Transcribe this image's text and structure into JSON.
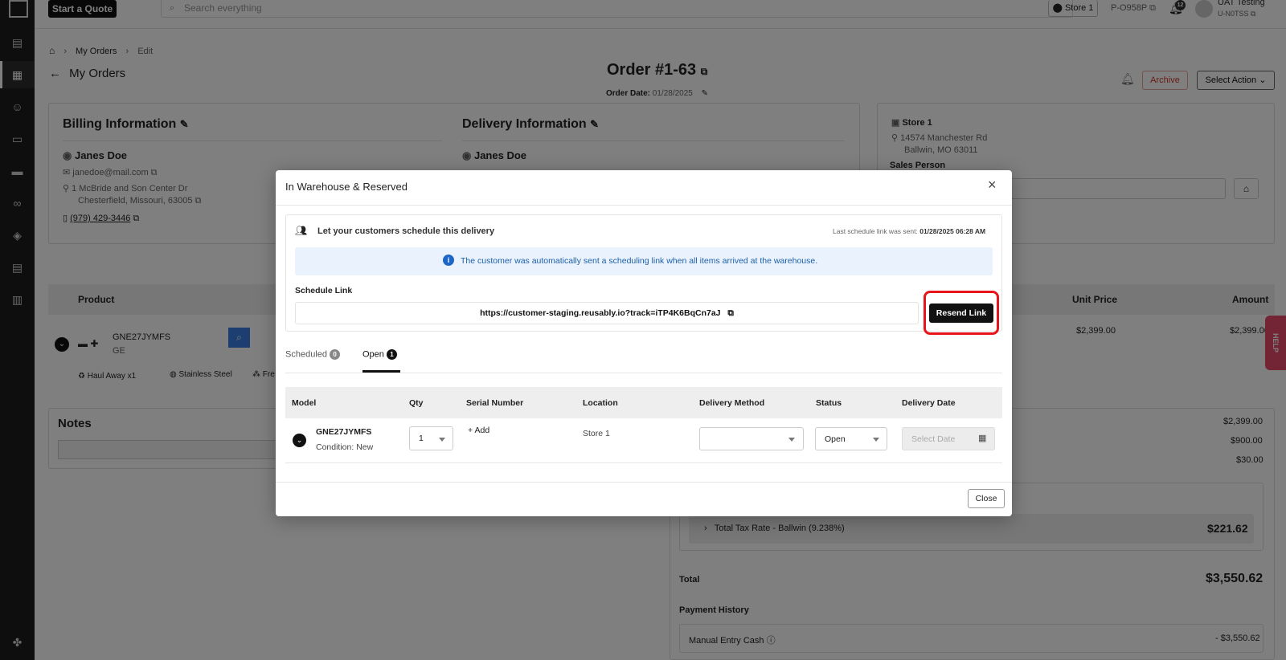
{
  "topbar": {
    "start_quote": "Start a Quote",
    "search_placeholder": "Search everything",
    "store": "Store 1",
    "store_code": "P-O958P",
    "notif_count": "12",
    "user_name": "UAT Testing",
    "user_code": "U-N0TSS"
  },
  "breadcrumb": {
    "my_orders": "My Orders",
    "edit": "Edit"
  },
  "page": {
    "back_label": "My Orders",
    "order_title": "Order #1-63",
    "order_date_label": "Order Date:",
    "order_date": "01/28/2025",
    "archive": "Archive",
    "select_action": "Select Action"
  },
  "billing": {
    "title": "Billing Information",
    "name": "Janes Doe",
    "email": "janedoe@mail.com",
    "address1": "1 McBride and Son Center Dr",
    "address2": "Chesterfield, Missouri, 63005",
    "phone": "(979) 429-3446"
  },
  "delivery_info": {
    "title": "Delivery Information",
    "name": "Janes Doe"
  },
  "store_card": {
    "name": "Store 1",
    "address1": "14574 Manchester Rd",
    "address2": "Ballwin, MO 63011",
    "sales_person": "Sales Person"
  },
  "products": {
    "col_product": "Product",
    "col_unit_price": "Unit Price",
    "col_amount": "Amount",
    "model": "GNE27JYMFS",
    "brand": "GE",
    "unit_price": "$2,399.00",
    "amount": "$2,399.00",
    "haul_away": "Haul Away x1",
    "finish": "Stainless Steel",
    "free": "Fre"
  },
  "notes": {
    "title": "Notes"
  },
  "summary": {
    "line1": "$2,399.00",
    "line2": "$900.00",
    "line3": "$30.00",
    "tax_label": "Total Tax Rate - Ballwin (9.238%)",
    "tax_value": "$221.62",
    "total_label": "Total",
    "total_value": "$3,550.62",
    "payment_history": "Payment History",
    "payment_label": "Manual Entry Cash",
    "payment_value": "- $3,550.62"
  },
  "help": "HELP",
  "modal": {
    "title": "In Warehouse & Reserved",
    "schedule_heading": "Let your customers schedule this delivery",
    "last_sent_label": "Last schedule link was sent:",
    "last_sent_value": "01/28/2025 06:28 AM",
    "info_text": "The customer was automatically sent a scheduling link when all items arrived at the warehouse.",
    "schedule_link_label": "Schedule Link",
    "schedule_link": "https://customer-staging.reusably.io?track=iTP4K6BqCn7aJ",
    "resend_link": "Resend Link",
    "tabs": [
      {
        "label": "Scheduled",
        "count": "0"
      },
      {
        "label": "Open",
        "count": "1"
      }
    ],
    "columns": {
      "model": "Model",
      "qty": "Qty",
      "serial": "Serial Number",
      "location": "Location",
      "method": "Delivery Method",
      "status": "Status",
      "date": "Delivery Date"
    },
    "row": {
      "model": "GNE27JYMFS",
      "condition": "Condition: New",
      "qty": "1",
      "add": "Add",
      "location": "Store 1",
      "method": "",
      "status": "Open",
      "date_placeholder": "Select Date"
    },
    "close": "Close"
  }
}
